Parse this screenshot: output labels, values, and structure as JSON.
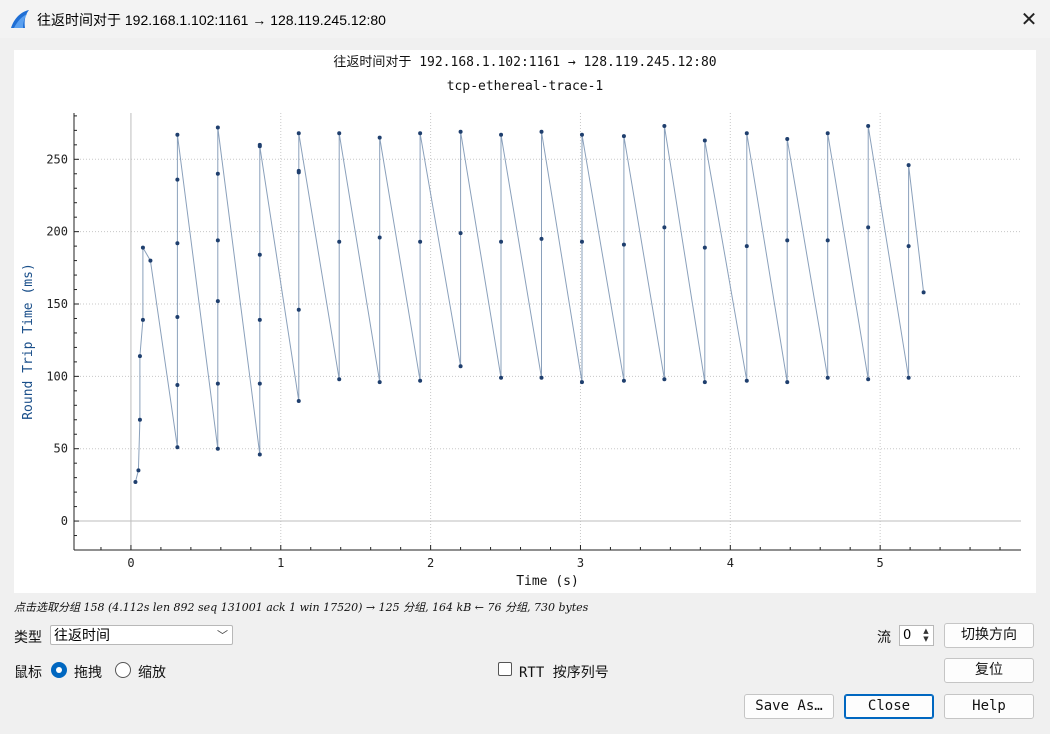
{
  "window": {
    "title": "往返时间对于 192.168.1.102:1161 → 128.119.245.12:80",
    "close_glyph": "✕"
  },
  "chart_data": {
    "type": "scatter",
    "title": "往返时间对于 192.168.1.102:1161 → 128.119.245.12:80",
    "subtitle": "tcp-ethereal-trace-1",
    "xlabel": "Time (s)",
    "ylabel": "Round Trip Time (ms)",
    "xlim": [
      -0.38,
      5.94
    ],
    "ylim": [
      -20,
      282
    ],
    "xticks": [
      0,
      1,
      2,
      3,
      4,
      5
    ],
    "yticks": [
      0,
      50,
      100,
      150,
      200,
      250
    ],
    "grid": true,
    "connected": true,
    "highlighted_index": 133,
    "points": [
      [
        0.03,
        27
      ],
      [
        0.05,
        35
      ],
      [
        0.06,
        70
      ],
      [
        0.06,
        114
      ],
      [
        0.08,
        139
      ],
      [
        0.08,
        189
      ],
      [
        0.13,
        180
      ],
      [
        0.31,
        51
      ],
      [
        0.31,
        94
      ],
      [
        0.31,
        141
      ],
      [
        0.31,
        192
      ],
      [
        0.31,
        236
      ],
      [
        0.31,
        267
      ],
      [
        0.58,
        50
      ],
      [
        0.58,
        95
      ],
      [
        0.58,
        152
      ],
      [
        0.58,
        194
      ],
      [
        0.58,
        240
      ],
      [
        0.58,
        272
      ],
      [
        0.86,
        46
      ],
      [
        0.86,
        95
      ],
      [
        0.86,
        139
      ],
      [
        0.86,
        184
      ],
      [
        0.86,
        260
      ],
      [
        0.86,
        259
      ],
      [
        1.12,
        83
      ],
      [
        1.12,
        146
      ],
      [
        1.12,
        241
      ],
      [
        1.12,
        242
      ],
      [
        1.12,
        268
      ],
      [
        1.39,
        98
      ],
      [
        1.39,
        193
      ],
      [
        1.39,
        268
      ],
      [
        1.66,
        96
      ],
      [
        1.66,
        196
      ],
      [
        1.66,
        265
      ],
      [
        1.93,
        97
      ],
      [
        1.93,
        193
      ],
      [
        1.93,
        268
      ],
      [
        2.2,
        107
      ],
      [
        2.2,
        199
      ],
      [
        2.2,
        269
      ],
      [
        2.47,
        99
      ],
      [
        2.47,
        193
      ],
      [
        2.47,
        267
      ],
      [
        2.74,
        99
      ],
      [
        2.74,
        195
      ],
      [
        2.74,
        269
      ],
      [
        3.01,
        96
      ],
      [
        3.01,
        193
      ],
      [
        3.01,
        267
      ],
      [
        3.29,
        97
      ],
      [
        3.29,
        191
      ],
      [
        3.29,
        266
      ],
      [
        3.56,
        98
      ],
      [
        3.56,
        203
      ],
      [
        3.56,
        273
      ],
      [
        3.83,
        96
      ],
      [
        3.83,
        189
      ],
      [
        3.83,
        263
      ],
      [
        4.11,
        97
      ],
      [
        4.11,
        190
      ],
      [
        4.11,
        268
      ],
      [
        4.38,
        96
      ],
      [
        4.38,
        194
      ],
      [
        4.38,
        264
      ],
      [
        4.65,
        99
      ],
      [
        4.65,
        194
      ],
      [
        4.65,
        268
      ],
      [
        4.92,
        98
      ],
      [
        4.92,
        203
      ],
      [
        4.92,
        273
      ],
      [
        5.19,
        99
      ],
      [
        5.19,
        190
      ],
      [
        5.19,
        246
      ],
      [
        5.29,
        158
      ]
    ]
  },
  "status": {
    "hint": "点击选取分组 158 (4.112s len 892 seq 131001 ack 1 win 17520) → 125 分组, 164 kB ← 76 分组, 730 bytes"
  },
  "controls": {
    "type_label": "类型",
    "type_value": "往返时间",
    "stream_label": "流",
    "stream_value": "0",
    "switch_direction": "切换方向",
    "mouse_label": "鼠标",
    "drag_label": "拖拽",
    "zoom_label": "缩放",
    "rtt_label": "RTT 按序列号",
    "reset": "复位",
    "save_as": "Save As…",
    "close": "Close",
    "help": "Help"
  },
  "colors": {
    "series": "#1f3f6e",
    "line": "#8aa0bb",
    "axis_label": "#1a4f8a"
  }
}
